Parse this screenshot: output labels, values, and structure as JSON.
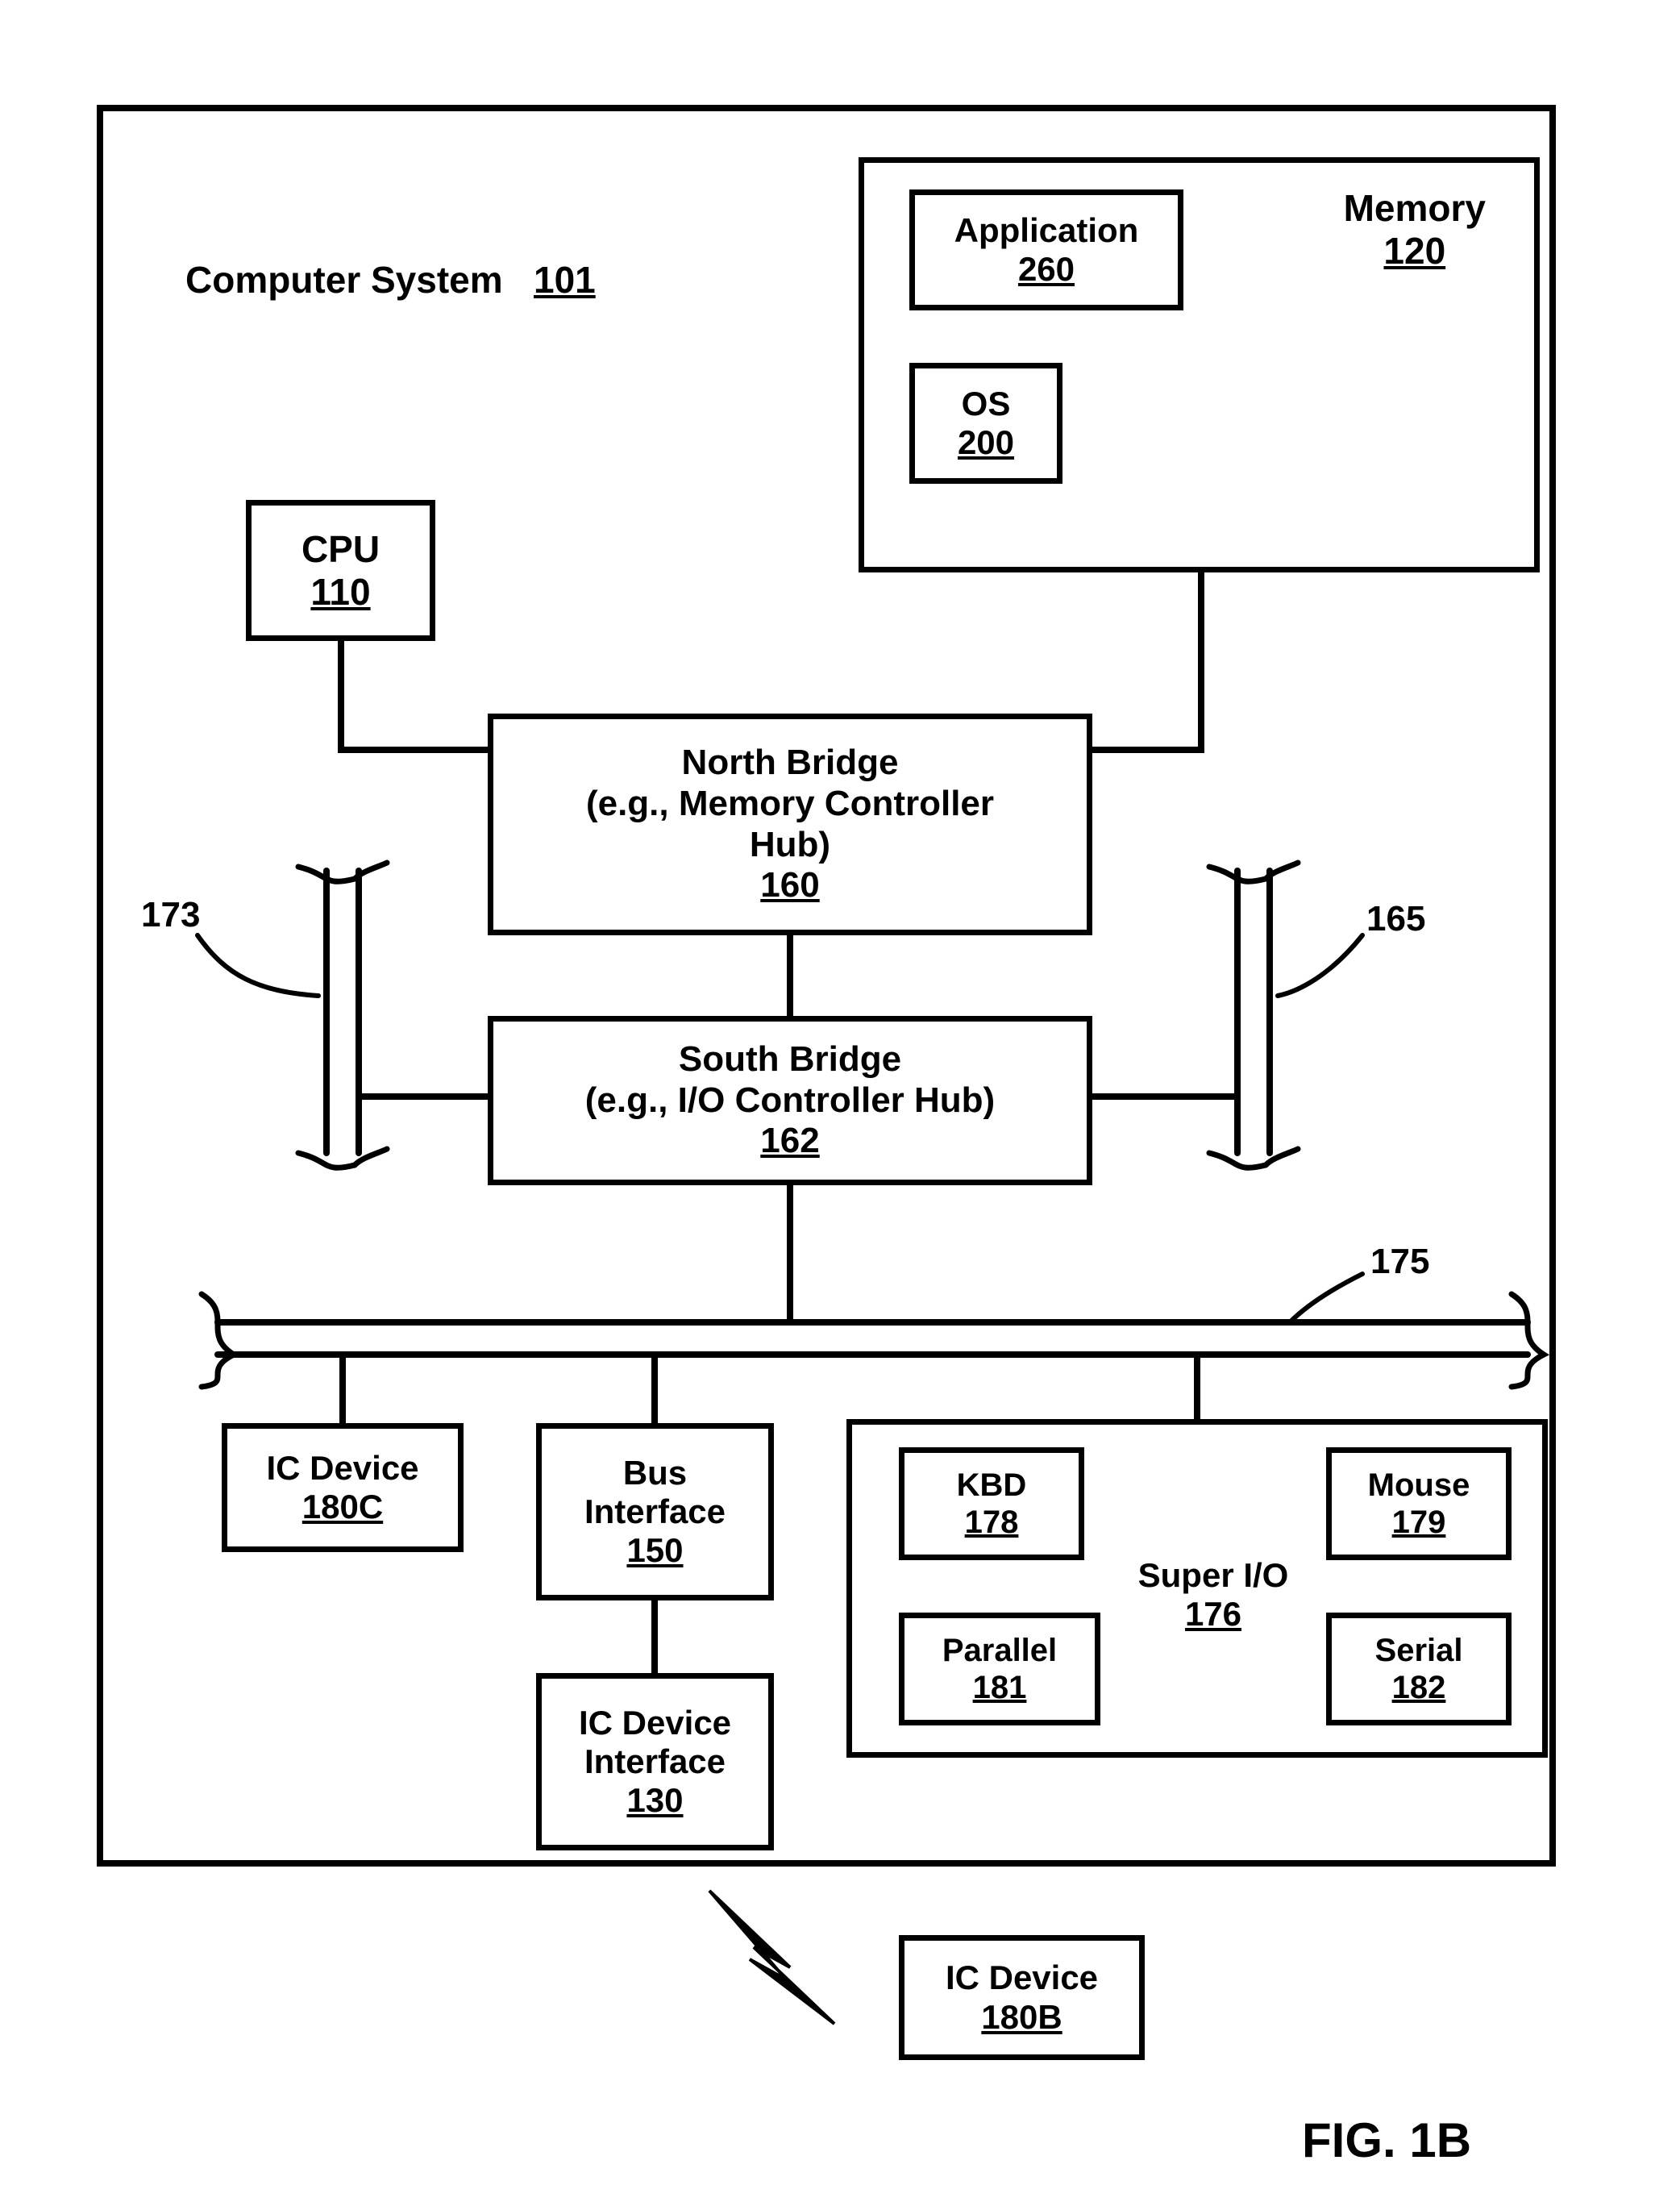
{
  "figure_caption": "FIG. 1B",
  "system_title": "Computer System",
  "system_ref": "101",
  "blocks": {
    "cpu": {
      "label": "CPU",
      "ref": "110"
    },
    "memory": {
      "label": "Memory",
      "ref": "120"
    },
    "application": {
      "label": "Application",
      "ref": "260"
    },
    "os": {
      "label": "OS",
      "ref": "200"
    },
    "north": {
      "line1": "North Bridge",
      "line2": "(e.g., Memory Controller",
      "line3": "Hub)",
      "ref": "160"
    },
    "south": {
      "line1": "South Bridge",
      "line2": "(e.g., I/O Controller Hub)",
      "ref": "162"
    },
    "ic180c": {
      "label": "IC Device",
      "ref": "180C"
    },
    "businterface": {
      "line1": "Bus",
      "line2": "Interface",
      "ref": "150"
    },
    "icdevif": {
      "line1": "IC Device",
      "line2": "Interface",
      "ref": "130"
    },
    "superio": {
      "label": "Super I/O",
      "ref": "176"
    },
    "kbd": {
      "label": "KBD",
      "ref": "178"
    },
    "mouse": {
      "label": "Mouse",
      "ref": "179"
    },
    "parallel": {
      "label": "Parallel",
      "ref": "181"
    },
    "serial": {
      "label": "Serial",
      "ref": "182"
    },
    "ic180b": {
      "label": "IC Device",
      "ref": "180B"
    }
  },
  "callouts": {
    "c173": "173",
    "c165": "165",
    "c175": "175"
  }
}
